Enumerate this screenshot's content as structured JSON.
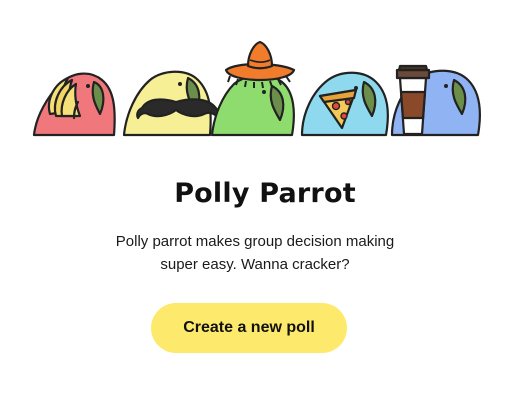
{
  "hero": {
    "parrots": [
      {
        "name": "parrot-with-banana",
        "body_color": "#f0787c",
        "prop": "banana"
      },
      {
        "name": "parrot-with-mustache",
        "body_color": "#f6ef96",
        "prop": "mustache"
      },
      {
        "name": "parrot-with-sombrero",
        "body_color": "#8fdc6e",
        "prop": "sombrero"
      },
      {
        "name": "parrot-with-pizza",
        "body_color": "#8fd9ef",
        "prop": "pizza-slice"
      },
      {
        "name": "parrot-with-coffee",
        "body_color": "#8fb3f3",
        "prop": "coffee-cup"
      }
    ]
  },
  "title": "Polly Parrot",
  "description": "Polly parrot makes group decision making super easy. Wanna cracker?",
  "cta": {
    "label": "Create a new poll",
    "color": "#fde96b"
  }
}
